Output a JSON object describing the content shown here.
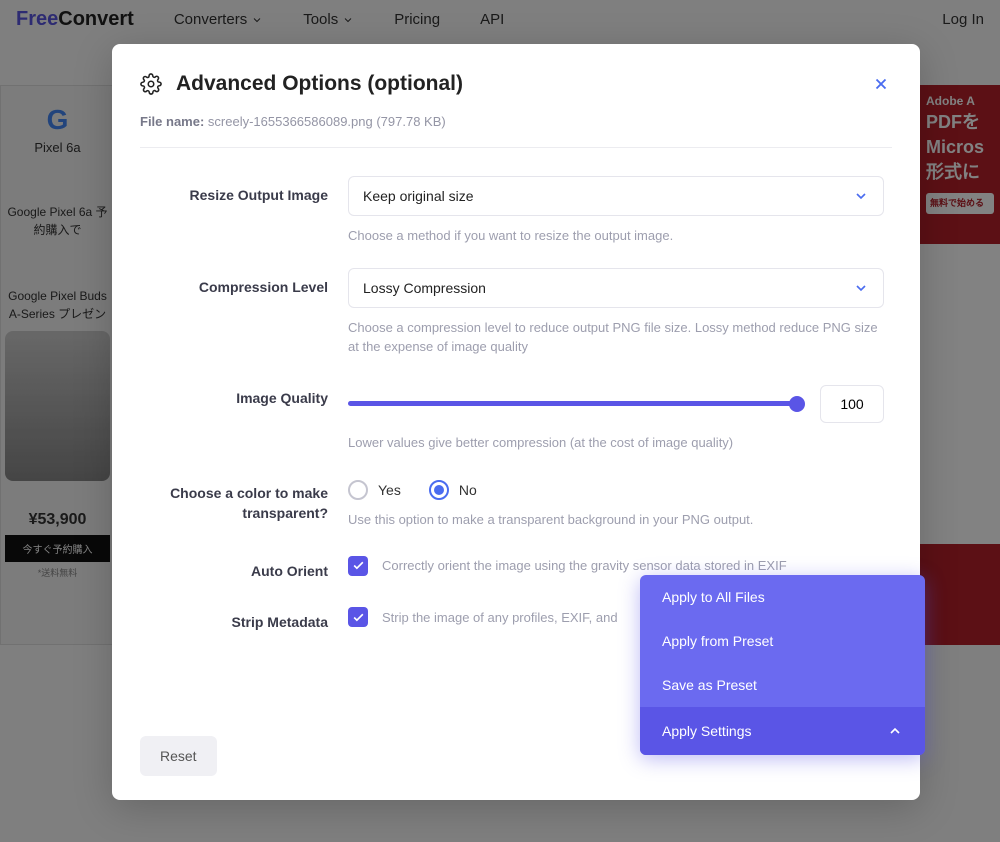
{
  "nav": {
    "logo_free": "Free",
    "logo_convert": "Convert",
    "converters": "Converters",
    "tools": "Tools",
    "pricing": "Pricing",
    "api": "API",
    "login": "Log In"
  },
  "ad_left": {
    "pixel": "Pixel 6a",
    "headline": "Google Pixel 6a 予約購入で",
    "sub": "Google Pixel Buds A-Series プレゼン",
    "price": "¥53,900",
    "cta": "今すぐ予約購入",
    "note": "*送料無料"
  },
  "ad_right": {
    "adobe": "Adobe A",
    "line1": "PDFを",
    "line2": "Micros",
    "line3": "形式に",
    "start": "無料で始める"
  },
  "modal": {
    "title": "Advanced Options (optional)",
    "file_label": "File name:",
    "file_value": "screely-1655366586089.png (797.78 KB)",
    "resize": {
      "label": "Resize Output Image",
      "value": "Keep original size",
      "help": "Choose a method if you want to resize the output image."
    },
    "compression": {
      "label": "Compression Level",
      "value": "Lossy Compression",
      "help": "Choose a compression level to reduce output PNG file size. Lossy method reduce PNG size at the expense of image quality"
    },
    "quality": {
      "label": "Image Quality",
      "value": "100",
      "help": "Lower values give better compression (at the cost of image quality)"
    },
    "transparent": {
      "label": "Choose a color to make transparent?",
      "yes": "Yes",
      "no": "No",
      "help": "Use this option to make a transparent background in your PNG output."
    },
    "auto_orient": {
      "label": "Auto Orient",
      "desc": "Correctly orient the image using the gravity sensor data stored in EXIF"
    },
    "strip": {
      "label": "Strip Metadata",
      "desc": "Strip the image of any profiles, EXIF, and"
    },
    "reset": "Reset",
    "apply_menu": {
      "all": "Apply to All Files",
      "from_preset": "Apply from Preset",
      "save_preset": "Save as Preset",
      "apply": "Apply Settings"
    }
  }
}
